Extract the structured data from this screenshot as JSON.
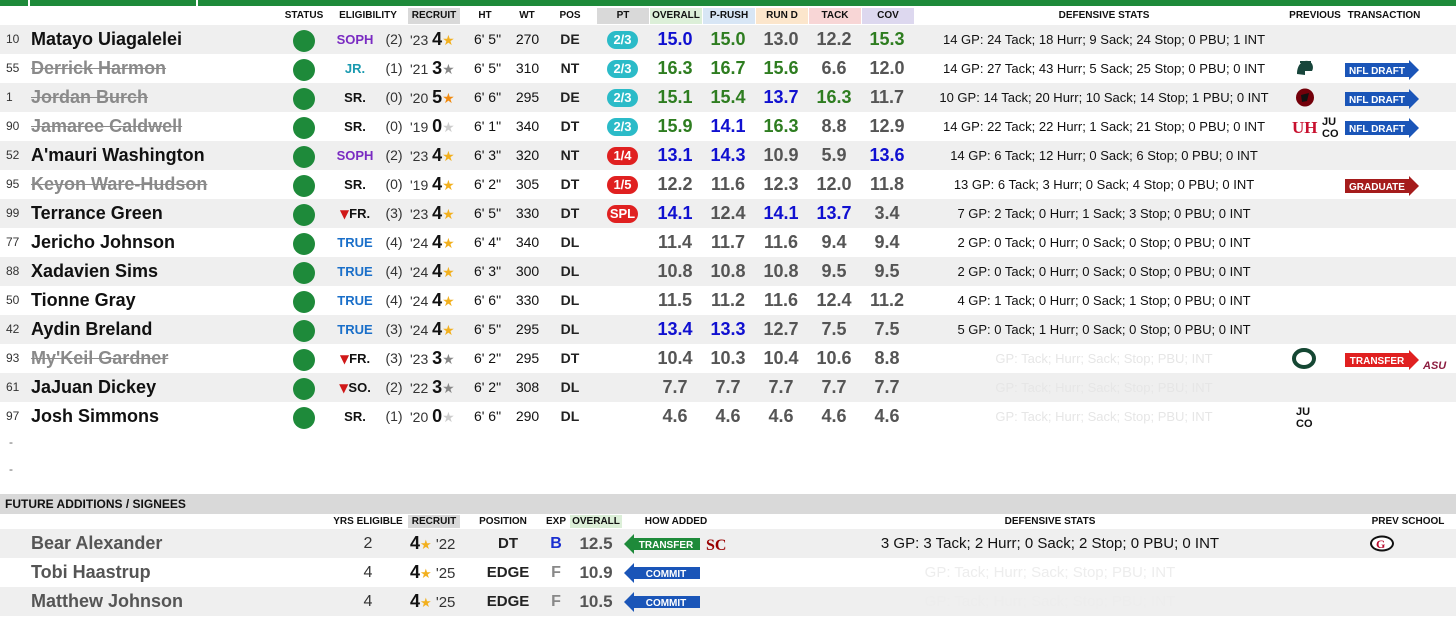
{
  "colors": {
    "green_status": "#1e8a3a",
    "score_blue": "#1010d0",
    "score_green": "#2e7d20",
    "score_gray": "#555555",
    "elig_purple": "#7a2bc2",
    "elig_blue": "#1a6fc9",
    "elig_teal": "#1a9ab0",
    "elig_red": "#d01818",
    "pt_teal": "#2bbbc8",
    "pt_red": "#e02020"
  },
  "headers": {
    "status": "STATUS",
    "eligibility": "ELIGIBILITY",
    "recruit": "RECRUIT",
    "ht": "HT",
    "wt": "WT",
    "pos": "POS",
    "pt": "PT",
    "overall": "OVERALL",
    "prush": "P-RUSH",
    "rund": "RUN D",
    "tack": "TACK",
    "cov": "COV",
    "defensive_stats": "DEFENSIVE STATS",
    "previous": "PREVIOUS",
    "transaction": "TRANSACTION"
  },
  "players": [
    {
      "num": "10",
      "name": "Matayo Uiagalelei",
      "struck": false,
      "elig": "SOPH",
      "elig_color": "purple",
      "yrs": "(2)",
      "rec_year": "'23",
      "stars": "4",
      "star_color": "gold",
      "ht": "6' 5\"",
      "wt": "270",
      "pos": "DE",
      "pt": "2/3",
      "pt_color": "teal",
      "overall": "15.0",
      "overall_c": "blue",
      "prush": "15.0",
      "prush_c": "green",
      "rund": "13.0",
      "rund_c": "gray",
      "tack": "12.2",
      "tack_c": "gray",
      "cov": "15.3",
      "cov_c": "green",
      "def": "14 GP: 24 Tack; 18 Hurr; 9 Sack; 24 Stop; 0 PBU; 1 INT",
      "def_faint": false,
      "prev": "",
      "transaction": ""
    },
    {
      "num": "55",
      "name": "Derrick Harmon",
      "struck": true,
      "elig": "JR.",
      "elig_color": "teal",
      "yrs": "(1)",
      "rec_year": "'21",
      "stars": "3",
      "star_color": "gray",
      "ht": "6' 5\"",
      "wt": "310",
      "pos": "NT",
      "pt": "2/3",
      "pt_color": "teal",
      "overall": "16.3",
      "overall_c": "green",
      "prush": "16.7",
      "prush_c": "green",
      "rund": "15.6",
      "rund_c": "green",
      "tack": "6.6",
      "tack_c": "gray",
      "cov": "12.0",
      "cov_c": "gray",
      "def": "14 GP: 27 Tack; 43 Hurr; 5 Sack; 25 Stop; 0 PBU; 0 INT",
      "def_faint": false,
      "prev": "msu",
      "transaction": "NFL DRAFT"
    },
    {
      "num": "1",
      "name": "Jordan Burch",
      "struck": true,
      "elig": "SR.",
      "elig_color": "black",
      "yrs": "(0)",
      "rec_year": "'20",
      "stars": "5",
      "star_color": "orange",
      "ht": "6' 6\"",
      "wt": "295",
      "pos": "DE",
      "pt": "2/3",
      "pt_color": "teal",
      "overall": "15.1",
      "overall_c": "green",
      "prush": "15.4",
      "prush_c": "green",
      "rund": "13.7",
      "rund_c": "blue",
      "tack": "16.3",
      "tack_c": "green",
      "cov": "11.7",
      "cov_c": "gray",
      "def": "10 GP: 14 Tack; 20 Hurr; 10 Sack; 14 Stop; 1 PBU; 0 INT",
      "def_faint": false,
      "prev": "sc",
      "transaction": "NFL DRAFT"
    },
    {
      "num": "90",
      "name": "Jamaree Caldwell",
      "struck": true,
      "elig": "SR.",
      "elig_color": "black",
      "yrs": "(0)",
      "rec_year": "'19",
      "stars": "0",
      "star_color": "none",
      "ht": "6' 1\"",
      "wt": "340",
      "pos": "DT",
      "pt": "2/3",
      "pt_color": "teal",
      "overall": "15.9",
      "overall_c": "green",
      "prush": "14.1",
      "prush_c": "blue",
      "rund": "16.3",
      "rund_c": "green",
      "tack": "8.8",
      "tack_c": "gray",
      "cov": "12.9",
      "cov_c": "gray",
      "def": "14 GP: 22 Tack; 22 Hurr; 1 Sack; 21 Stop; 0 PBU; 0 INT",
      "def_faint": false,
      "prev": "uh-juco",
      "transaction": "NFL DRAFT"
    },
    {
      "num": "52",
      "name": "A'mauri Washington",
      "struck": false,
      "elig": "SOPH",
      "elig_color": "purple",
      "yrs": "(2)",
      "rec_year": "'23",
      "stars": "4",
      "star_color": "gold",
      "ht": "6' 3\"",
      "wt": "320",
      "pos": "NT",
      "pt": "1/4",
      "pt_color": "red",
      "overall": "13.1",
      "overall_c": "blue",
      "prush": "14.3",
      "prush_c": "blue",
      "rund": "10.9",
      "rund_c": "gray",
      "tack": "5.9",
      "tack_c": "gray",
      "cov": "13.6",
      "cov_c": "blue",
      "def": "14 GP: 6 Tack; 12 Hurr; 0 Sack; 6 Stop; 0 PBU; 0 INT",
      "def_faint": false,
      "prev": "",
      "transaction": ""
    },
    {
      "num": "95",
      "name": "Keyon Ware-Hudson",
      "struck": true,
      "elig": "SR.",
      "elig_color": "black",
      "yrs": "(0)",
      "rec_year": "'19",
      "stars": "4",
      "star_color": "gold",
      "ht": "6' 2\"",
      "wt": "305",
      "pos": "DT",
      "pt": "1/5",
      "pt_color": "red",
      "overall": "12.2",
      "overall_c": "gray",
      "prush": "11.6",
      "prush_c": "gray",
      "rund": "12.3",
      "rund_c": "gray",
      "tack": "12.0",
      "tack_c": "gray",
      "cov": "11.8",
      "cov_c": "gray",
      "def": "13 GP: 6 Tack; 3 Hurr; 0 Sack; 4 Stop; 0 PBU; 0 INT",
      "def_faint": false,
      "prev": "",
      "transaction": "GRADUATE"
    },
    {
      "num": "99",
      "name": "Terrance Green",
      "struck": false,
      "elig": "FR.",
      "elig_color": "black",
      "redshirt": true,
      "yrs": "(3)",
      "rec_year": "'23",
      "stars": "4",
      "star_color": "gold",
      "ht": "6' 5\"",
      "wt": "330",
      "pos": "DT",
      "pt": "SPL",
      "pt_color": "red",
      "overall": "14.1",
      "overall_c": "blue",
      "prush": "12.4",
      "prush_c": "gray",
      "rund": "14.1",
      "rund_c": "blue",
      "tack": "13.7",
      "tack_c": "blue",
      "cov": "3.4",
      "cov_c": "gray",
      "def": "7 GP: 2 Tack; 0 Hurr; 1 Sack; 3 Stop; 0 PBU; 0 INT",
      "def_faint": false,
      "prev": "",
      "transaction": ""
    },
    {
      "num": "77",
      "name": "Jericho Johnson",
      "struck": false,
      "elig": "TRUE",
      "elig_color": "blue",
      "yrs": "(4)",
      "rec_year": "'24",
      "stars": "4",
      "star_color": "gold",
      "ht": "6' 4\"",
      "wt": "340",
      "pos": "DL",
      "pt": "",
      "pt_color": "none",
      "overall": "11.4",
      "overall_c": "gray",
      "prush": "11.7",
      "prush_c": "gray",
      "rund": "11.6",
      "rund_c": "gray",
      "tack": "9.4",
      "tack_c": "gray",
      "cov": "9.4",
      "cov_c": "gray",
      "def": "2 GP: 0 Tack; 0 Hurr; 0 Sack; 0 Stop; 0 PBU; 0 INT",
      "def_faint": false,
      "prev": "",
      "transaction": ""
    },
    {
      "num": "88",
      "name": "Xadavien Sims",
      "struck": false,
      "elig": "TRUE",
      "elig_color": "blue",
      "yrs": "(4)",
      "rec_year": "'24",
      "stars": "4",
      "star_color": "gold",
      "ht": "6' 3\"",
      "wt": "300",
      "pos": "DL",
      "pt": "",
      "pt_color": "none",
      "overall": "10.8",
      "overall_c": "gray",
      "prush": "10.8",
      "prush_c": "gray",
      "rund": "10.8",
      "rund_c": "gray",
      "tack": "9.5",
      "tack_c": "gray",
      "cov": "9.5",
      "cov_c": "gray",
      "def": "2 GP: 0 Tack; 0 Hurr; 0 Sack; 0 Stop; 0 PBU; 0 INT",
      "def_faint": false,
      "prev": "",
      "transaction": ""
    },
    {
      "num": "50",
      "name": "Tionne Gray",
      "struck": false,
      "elig": "TRUE",
      "elig_color": "blue",
      "yrs": "(4)",
      "rec_year": "'24",
      "stars": "4",
      "star_color": "gold",
      "ht": "6' 6\"",
      "wt": "330",
      "pos": "DL",
      "pt": "",
      "pt_color": "none",
      "overall": "11.5",
      "overall_c": "gray",
      "prush": "11.2",
      "prush_c": "gray",
      "rund": "11.6",
      "rund_c": "gray",
      "tack": "12.4",
      "tack_c": "gray",
      "cov": "11.2",
      "cov_c": "gray",
      "def": "4 GP: 1 Tack; 0 Hurr; 0 Sack; 1 Stop; 0 PBU; 0 INT",
      "def_faint": false,
      "prev": "",
      "transaction": ""
    },
    {
      "num": "42",
      "name": "Aydin Breland",
      "struck": false,
      "elig": "TRUE",
      "elig_color": "blue",
      "yrs": "(3)",
      "rec_year": "'24",
      "stars": "4",
      "star_color": "gold",
      "ht": "6' 5\"",
      "wt": "295",
      "pos": "DL",
      "pt": "",
      "pt_color": "none",
      "overall": "13.4",
      "overall_c": "blue",
      "prush": "13.3",
      "prush_c": "blue",
      "rund": "12.7",
      "rund_c": "gray",
      "tack": "7.5",
      "tack_c": "gray",
      "cov": "7.5",
      "cov_c": "gray",
      "def": "5 GP: 0 Tack; 1 Hurr; 0 Sack; 0 Stop; 0 PBU; 0 INT",
      "def_faint": false,
      "prev": "",
      "transaction": ""
    },
    {
      "num": "93",
      "name": "My'Keil Gardner",
      "struck": true,
      "elig": "FR.",
      "elig_color": "black",
      "redshirt": true,
      "yrs": "(3)",
      "rec_year": "'23",
      "stars": "3",
      "star_color": "gray",
      "ht": "6' 2\"",
      "wt": "295",
      "pos": "DT",
      "pt": "",
      "pt_color": "none",
      "overall": "10.4",
      "overall_c": "gray",
      "prush": "10.3",
      "prush_c": "gray",
      "rund": "10.4",
      "rund_c": "gray",
      "tack": "10.6",
      "tack_c": "gray",
      "cov": "8.8",
      "cov_c": "gray",
      "def": "GP: Tack; Hurr; Sack; Stop; PBU; INT",
      "def_faint": true,
      "prev": "oregon",
      "transaction": "TRANSFER",
      "transaction_dest": "ASU"
    },
    {
      "num": "61",
      "name": "JaJuan Dickey",
      "struck": false,
      "elig": "SO.",
      "elig_color": "black",
      "redshirt": true,
      "yrs": "(2)",
      "rec_year": "'22",
      "stars": "3",
      "star_color": "gray",
      "ht": "6' 2\"",
      "wt": "308",
      "pos": "DL",
      "pt": "",
      "pt_color": "none",
      "overall": "7.7",
      "overall_c": "gray",
      "prush": "7.7",
      "prush_c": "gray",
      "rund": "7.7",
      "rund_c": "gray",
      "tack": "7.7",
      "tack_c": "gray",
      "cov": "7.7",
      "cov_c": "gray",
      "def": "GP: Tack; Hurr; Sack; Stop; PBU; INT",
      "def_faint": true,
      "prev": "",
      "transaction": ""
    },
    {
      "num": "97",
      "name": "Josh Simmons",
      "struck": false,
      "elig": "SR.",
      "elig_color": "black",
      "yrs": "(1)",
      "rec_year": "'20",
      "stars": "0",
      "star_color": "none",
      "ht": "6' 6\"",
      "wt": "290",
      "pos": "DL",
      "pt": "",
      "pt_color": "none",
      "overall": "4.6",
      "overall_c": "gray",
      "prush": "4.6",
      "prush_c": "gray",
      "rund": "4.6",
      "rund_c": "gray",
      "tack": "4.6",
      "tack_c": "gray",
      "cov": "4.6",
      "cov_c": "gray",
      "def": "GP: Tack; Hurr; Sack; Stop; PBU; INT",
      "def_faint": true,
      "prev": "juco",
      "transaction": ""
    }
  ],
  "blank_rows": [
    "-",
    "-"
  ],
  "future": {
    "section_title": "FUTURE ADDITIONS / SIGNEES",
    "headers": {
      "yrs_eligible": "YRS ELIGIBLE",
      "recruit": "RECRUIT",
      "position": "POSITION",
      "exp": "EXP",
      "overall": "OVERALL",
      "how_added": "HOW ADDED",
      "defensive_stats": "DEFENSIVE STATS",
      "prev_school": "PREV SCHOOL"
    },
    "rows": [
      {
        "name": "Bear Alexander",
        "yrs": "2",
        "stars": "4",
        "rec_year": "'22",
        "pos": "DT",
        "exp": "B",
        "exp_color": "blue",
        "overall": "12.5",
        "how": "TRANSFER",
        "how_color": "green",
        "how_school": "usc",
        "def": "3 GP: 3 Tack; 2 Hurr; 0 Sack; 2 Stop; 0 PBU; 0 INT",
        "def_faint": false,
        "prev_school": "georgia"
      },
      {
        "name": "Tobi Haastrup",
        "yrs": "4",
        "stars": "4",
        "rec_year": "'25",
        "pos": "EDGE",
        "exp": "F",
        "exp_color": "gray",
        "overall": "10.9",
        "how": "COMMIT",
        "how_color": "blue",
        "how_school": "",
        "def": "GP: Tack; Hurr; Sack; Stop; PBU; INT",
        "def_faint": true,
        "prev_school": ""
      },
      {
        "name": "Matthew Johnson",
        "yrs": "4",
        "stars": "4",
        "rec_year": "'25",
        "pos": "EDGE",
        "exp": "F",
        "exp_color": "gray",
        "overall": "10.5",
        "how": "COMMIT",
        "how_color": "blue",
        "how_school": "",
        "def": "GP: Tack; Hurr; Sack; Stop; PBU; INT",
        "def_faint": true,
        "prev_school": ""
      }
    ]
  },
  "logos": {
    "juco_top": "JU",
    "juco_bottom": "CO",
    "asu": "ASU",
    "usc": "SC",
    "georgia": "G"
  }
}
